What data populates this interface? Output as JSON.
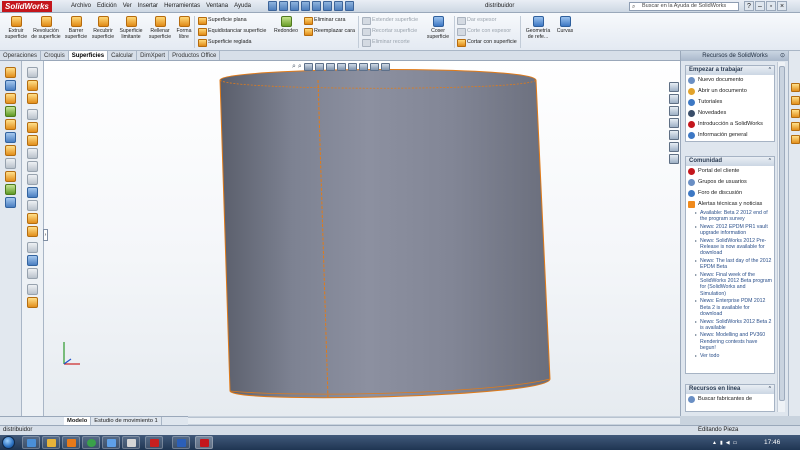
{
  "app": {
    "logo_text": "SolidWorks",
    "document_title": "distribuidor",
    "help_search_placeholder": "Buscar en la Ayuda de SolidWorks"
  },
  "menu": [
    "Archivo",
    "Edición",
    "Ver",
    "Insertar",
    "Herramientas",
    "Ventana",
    "Ayuda"
  ],
  "ribbon": {
    "extrude": "Extruir superficie",
    "revolve": "Revolución de superficie",
    "sweep": "Barrer superficie",
    "loft": "Recubrir superficie",
    "boundary": "Superficie limitante",
    "fill": "Rellenar superficie",
    "freeform": "Forma libre",
    "planar": "Superficie plana",
    "offset": "Equidistanciar superficie",
    "ruled": "Superficie reglada",
    "fillet": "Redondeo",
    "delete_face": "Eliminar cara",
    "replace_face": "Reemplazar cara",
    "extend": "Extender superficie",
    "trim": "Recortar superficie",
    "untrim": "Eliminar recorte",
    "knit": "Coser superficie",
    "thicken": "Dar espesor",
    "thicken_cut": "Corte con espesor",
    "surface_cut": "Cortar con superficie",
    "ref_geometry": "Geometría de refe...",
    "curves": "Curvas"
  },
  "tabs": [
    {
      "label": "Operaciones",
      "active": false
    },
    {
      "label": "Croquis",
      "active": false
    },
    {
      "label": "Superficies",
      "active": true
    },
    {
      "label": "Calcular",
      "active": false
    },
    {
      "label": "DimXpert",
      "active": false
    },
    {
      "label": "Productos Office",
      "active": false
    }
  ],
  "taskpane": {
    "title": "Recursos de SolidWorks",
    "start": {
      "title": "Empezar a trabajar",
      "items": [
        "Nuevo documento",
        "Abrir un documento",
        "Tutoriales",
        "Novedades",
        "Introducción a SolidWorks",
        "Información general"
      ]
    },
    "community": {
      "title": "Comunidad",
      "items": [
        "Portal del cliente",
        "Grupos de usuarios",
        "Foro de discusión",
        "Alertas técnicas y noticias"
      ]
    },
    "news": [
      "Available: Beta 2 2012 end of the program survey",
      "News: 2012 EPDM PR1 vault upgrade information",
      "News: SolidWorks 2012 Pre-Release is now available for download",
      "News: The last day of the 2012 EPDM Beta",
      "News: Final week of the SolidWorks 2012 Beta program for (SolidWorks and Simulation)",
      "News: Enterprise PDM 2012 Beta 2 is available for download",
      "News: SolidWorks 2012 Beta 2 is available",
      "News: Modelling and PV360 Rendering contests have begun!",
      "Ver todo"
    ],
    "online": {
      "title": "Recursos en línea",
      "items": [
        "Buscar fabricantes de"
      ]
    }
  },
  "bottom_tabs": [
    {
      "label": "Modelo",
      "active": true
    },
    {
      "label": "Estudio de movimiento 1",
      "active": false
    }
  ],
  "status": {
    "left": "distribuidor",
    "right": "Editando Pieza"
  },
  "taskbar": {
    "clock": "17:46"
  }
}
